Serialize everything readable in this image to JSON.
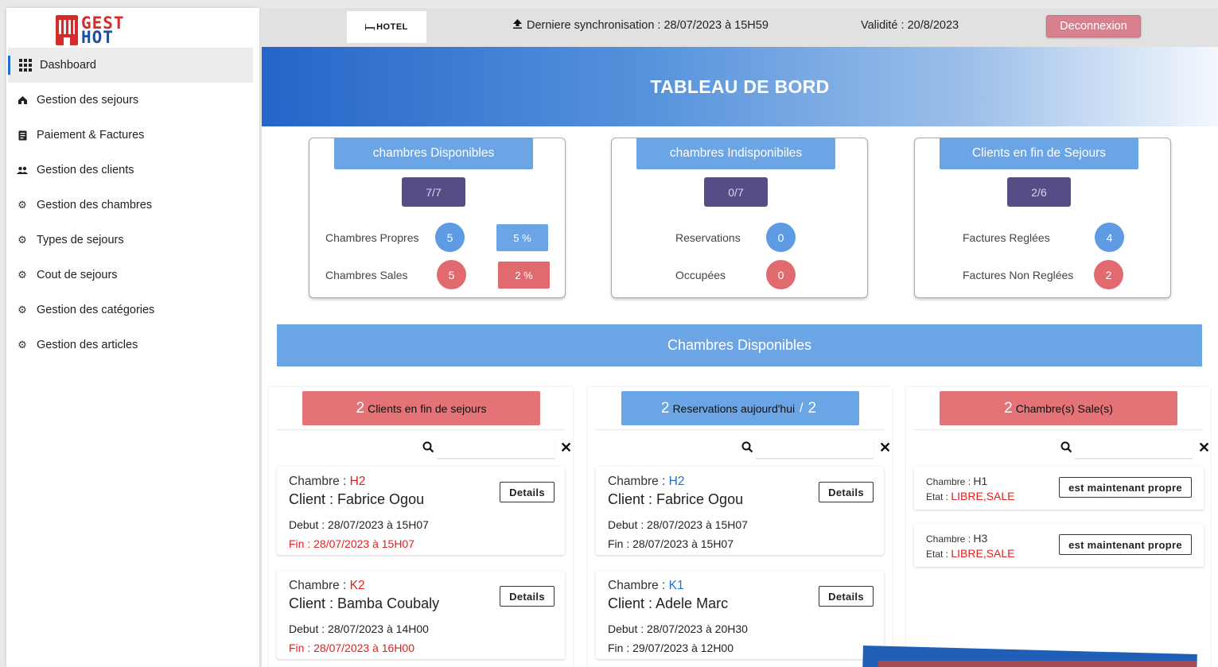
{
  "brand": {
    "logo_line1": "GEST",
    "logo_line2": "HOT"
  },
  "sidebar": {
    "items": [
      {
        "label": "Dashboard",
        "icon": "grid-icon"
      },
      {
        "label": "Gestion des sejours",
        "icon": "home-icon"
      },
      {
        "label": "Paiement & Factures",
        "icon": "receipt-icon"
      },
      {
        "label": "Gestion des clients",
        "icon": "people-icon"
      },
      {
        "label": "Gestion des chambres",
        "icon": "gear-icon"
      },
      {
        "label": "Types de sejours",
        "icon": "gear-icon"
      },
      {
        "label": "Cout de sejours",
        "icon": "gear-icon"
      },
      {
        "label": "Gestion des catégories",
        "icon": "gear-icon"
      },
      {
        "label": "Gestion des articles",
        "icon": "gear-icon"
      }
    ]
  },
  "topbar": {
    "hotel_label": "HOTEL",
    "sync_text": "Derniere synchronisation : 28/07/2023 à 15H59",
    "validity_text": "Validité : 20/8/2023",
    "logout_label": "Deconnexion"
  },
  "banner": {
    "title": "TABLEAU DE BORD"
  },
  "stats": {
    "disponibles": {
      "title": "chambres Disponibles",
      "total": "7/7",
      "row1_label": "Chambres Propres",
      "row1_value": "5",
      "row1_pct": "5 %",
      "row2_label": "Chambres Sales",
      "row2_value": "5",
      "row2_pct": "2 %"
    },
    "indisponibles": {
      "title": "chambres Indisponibiles",
      "total": "0/7",
      "row1_label": "Reservations",
      "row1_value": "0",
      "row2_label": "Occupées",
      "row2_value": "0"
    },
    "fin_sejours": {
      "title": "Clients en fin de Sejours",
      "total": "2/6",
      "row1_label": "Factures Reglées",
      "row1_value": "4",
      "row2_label": "Factures Non Reglées",
      "row2_value": "2"
    }
  },
  "section_title": "Chambres Disponibles",
  "columns": {
    "fin": {
      "count": "2",
      "label": "Clients en fin de sejours",
      "cards": [
        {
          "chambre_label": "Chambre : ",
          "chambre": "H2",
          "client_label": "Client : ",
          "client": "Fabrice Ogou",
          "debut": "Debut : 28/07/2023 à 15H07",
          "fin": "Fin : 28/07/2023 à 15H07",
          "details": "Details"
        },
        {
          "chambre_label": "Chambre : ",
          "chambre": "K2",
          "client_label": "Client : ",
          "client": "Bamba Coubaly",
          "debut": "Debut : 28/07/2023 à 14H00",
          "fin": "Fin : 28/07/2023 à 16H00",
          "details": "Details"
        }
      ]
    },
    "reservations": {
      "count": "2",
      "label": "Reservations aujourd'hui",
      "sep": "/",
      "count2": "2",
      "cards": [
        {
          "chambre_label": "Chambre : ",
          "chambre": "H2",
          "client_label": "Client : ",
          "client": "Fabrice Ogou",
          "debut": "Debut : 28/07/2023 à 15H07",
          "fin": "Fin : 28/07/2023 à 15H07",
          "details": "Details"
        },
        {
          "chambre_label": "Chambre : ",
          "chambre": "K1",
          "client_label": "Client : ",
          "client": "Adele Marc",
          "debut": "Debut : 28/07/2023 à 20H30",
          "fin": "Fin : 29/07/2023 à 12H00",
          "details": "Details"
        }
      ]
    },
    "sales": {
      "count": "2",
      "label": "Chambre(s) Sale(s)",
      "cards": [
        {
          "chambre_label": "Chambre : ",
          "chambre": "H1",
          "etat_label": "Etat : ",
          "etat": "LIBRE,SALE",
          "action": "est maintenant propre"
        },
        {
          "chambre_label": "Chambre : ",
          "chambre": "H3",
          "etat_label": "Etat : ",
          "etat": "LIBRE,SALE",
          "action": "est maintenant propre"
        }
      ]
    }
  },
  "colors": {
    "accent_blue": "#6ba5e6",
    "accent_red": "#e37376",
    "dark_badge": "#564d86",
    "logout": "#d9808e"
  }
}
